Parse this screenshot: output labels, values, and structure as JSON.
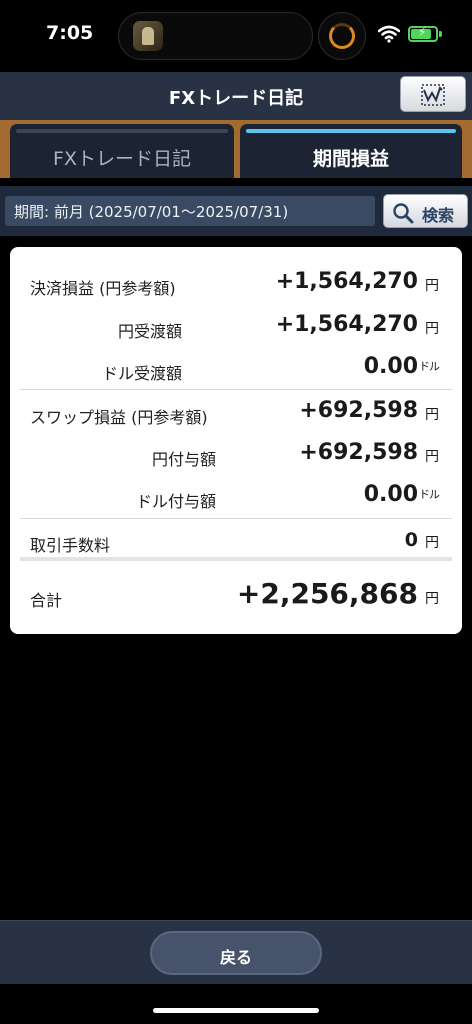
{
  "status_bar": {
    "time": "7:05"
  },
  "header": {
    "title": "FXトレード日記",
    "chart_button_icon": "line-chart-icon"
  },
  "tabs": [
    {
      "label": "FXトレード日記",
      "active": false
    },
    {
      "label": "期間損益",
      "active": true
    }
  ],
  "period": {
    "text": "期間: 前月 (2025/07/01〜2025/07/31)",
    "search_label": "検索"
  },
  "summary": {
    "settlement": {
      "label": "決済損益 (円参考額)",
      "value": "+1,564,270",
      "unit": "円"
    },
    "yen_received": {
      "label": "円受渡額",
      "value": "+1,564,270",
      "unit": "円"
    },
    "dollar_received": {
      "label": "ドル受渡額",
      "value": "0.00",
      "unit": "ドル"
    },
    "swap": {
      "label": "スワップ損益 (円参考額)",
      "value": "+692,598",
      "unit": "円"
    },
    "yen_granted": {
      "label": "円付与額",
      "value": "+692,598",
      "unit": "円"
    },
    "dollar_granted": {
      "label": "ドル付与額",
      "value": "0.00",
      "unit": "ドル"
    },
    "fee": {
      "label": "取引手数料",
      "value": "0",
      "unit": "円"
    },
    "total": {
      "label": "合計",
      "value": "+2,256,868",
      "unit": "円"
    }
  },
  "footer": {
    "back_label": "戻る"
  }
}
